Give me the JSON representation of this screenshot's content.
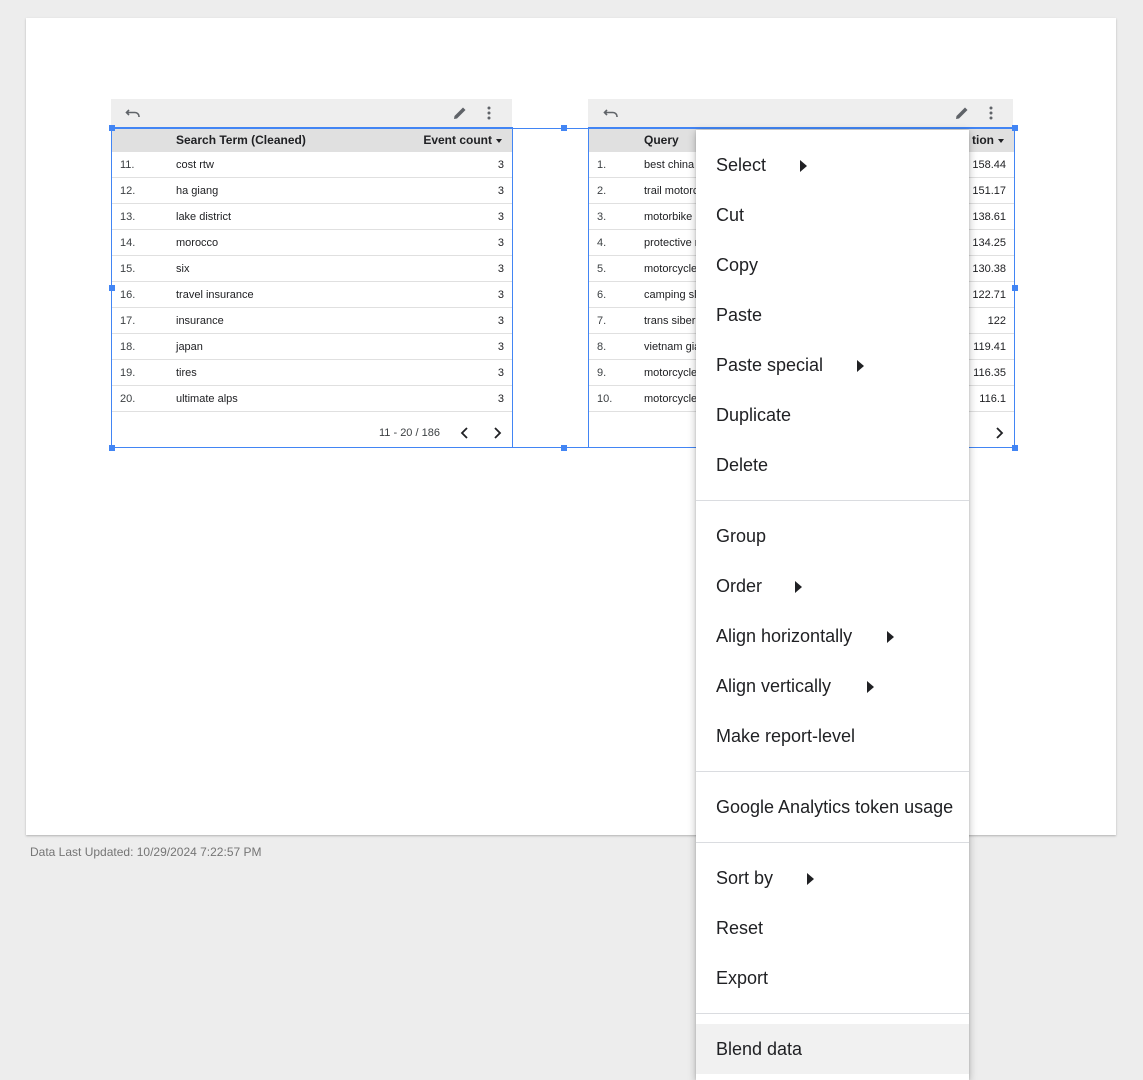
{
  "footer": {
    "last_updated": "Data Last Updated: 10/29/2024 7:22:57 PM"
  },
  "icons": {
    "undo": "undo-icon",
    "edit": "pencil-icon",
    "more": "more-vert-icon",
    "prev": "chevron-left-icon",
    "next": "chevron-right-icon"
  },
  "colors": {
    "selection": "#4285f4",
    "header_bg": "#e0e0e0",
    "canvas_bg": "#ededed"
  },
  "table1": {
    "col1": "Search Term (Cleaned)",
    "col2": "Event count",
    "rows": [
      {
        "n": "11.",
        "term": "cost rtw",
        "count": "3"
      },
      {
        "n": "12.",
        "term": "ha giang",
        "count": "3"
      },
      {
        "n": "13.",
        "term": "lake district",
        "count": "3"
      },
      {
        "n": "14.",
        "term": "morocco",
        "count": "3"
      },
      {
        "n": "15.",
        "term": "six",
        "count": "3"
      },
      {
        "n": "16.",
        "term": "travel insurance",
        "count": "3"
      },
      {
        "n": "17.",
        "term": "insurance",
        "count": "3"
      },
      {
        "n": "18.",
        "term": "japan",
        "count": "3"
      },
      {
        "n": "19.",
        "term": "tires",
        "count": "3"
      },
      {
        "n": "20.",
        "term": "ultimate alps",
        "count": "3"
      }
    ],
    "pager": "11 - 20 / 186"
  },
  "table2": {
    "col1": "Query",
    "col2": "tion",
    "rows": [
      {
        "n": "1.",
        "term": "best china",
        "val": "158.44"
      },
      {
        "n": "2.",
        "term": "trail motorc",
        "val": "151.17"
      },
      {
        "n": "3.",
        "term": "motorbike",
        "val": "138.61"
      },
      {
        "n": "4.",
        "term": "protective r",
        "val": "134.25"
      },
      {
        "n": "5.",
        "term": "motorcycle",
        "val": "130.38"
      },
      {
        "n": "6.",
        "term": "camping sl",
        "val": "122.71"
      },
      {
        "n": "7.",
        "term": "trans siberi",
        "val": "122"
      },
      {
        "n": "8.",
        "term": "vietnam gia",
        "val": "119.41"
      },
      {
        "n": "9.",
        "term": "motorcycle",
        "val": "116.35"
      },
      {
        "n": "10.",
        "term": "motorcycle",
        "val": "116.1"
      }
    ]
  },
  "menu": {
    "select": "Select",
    "cut": "Cut",
    "copy": "Copy",
    "paste": "Paste",
    "paste_special": "Paste special",
    "duplicate": "Duplicate",
    "delete": "Delete",
    "group": "Group",
    "order": "Order",
    "align_h": "Align horizontally",
    "align_v": "Align vertically",
    "report_level": "Make report-level",
    "ga_token": "Google Analytics token usage",
    "sort_by": "Sort by",
    "reset": "Reset",
    "export": "Export",
    "blend": "Blend data"
  }
}
